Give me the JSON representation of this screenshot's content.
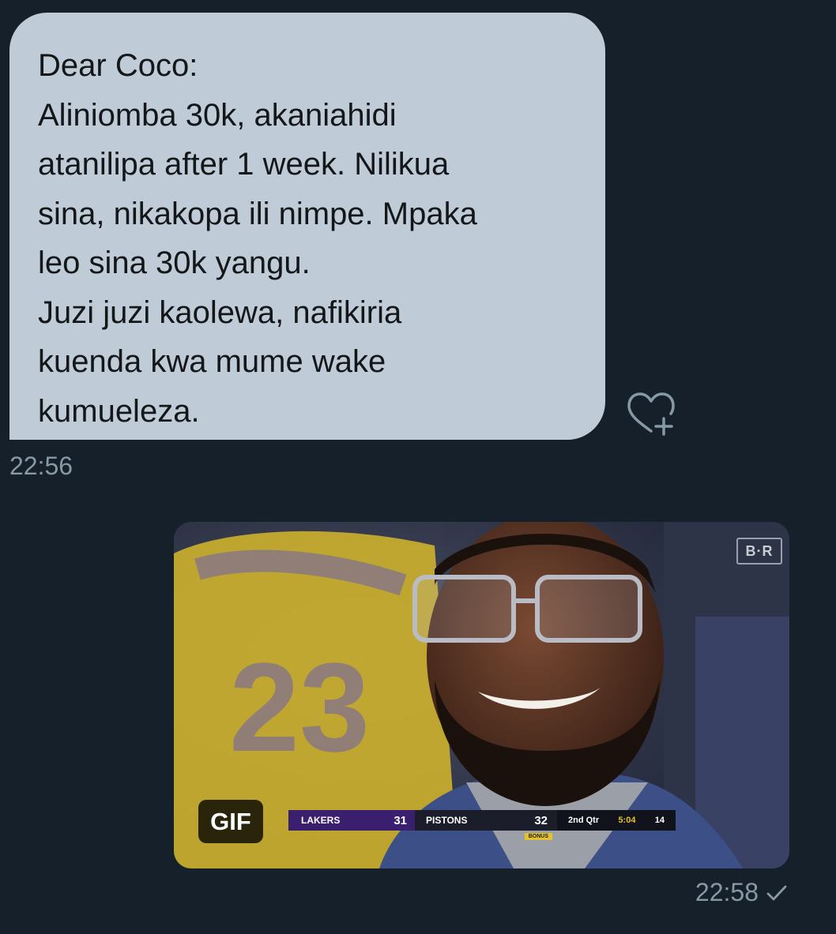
{
  "incoming_message": {
    "lines": [
      "Dear Coco:",
      "Aliniomba 30k, akaniahidi",
      "atanilipa after 1 week. Nilikua",
      "sina, nikakopa ili nimpe. Mpaka",
      "leo sina 30k yangu.",
      "Juzi juzi kaolewa, nafikiria",
      "kuenda kwa mume wake",
      "kumueleza."
    ],
    "timestamp": "22:56",
    "reaction_icon": "heart-plus-icon"
  },
  "outgoing_message": {
    "media_type_label": "GIF",
    "timestamp": "22:58",
    "status_icon": "checkmark-icon",
    "gif_overlay": {
      "watermark": "B·R",
      "scoreboard": {
        "team1": "LAKERS",
        "score1": "31",
        "team2": "PISTONS",
        "score2": "32",
        "bonus": "BONUS",
        "quarter": "2nd Qtr",
        "clock": "5:04",
        "shot_clock": "14"
      }
    }
  },
  "colors": {
    "background": "#15202b",
    "incoming_bubble": "#bfcbd6",
    "meta_text": "#8899a6"
  }
}
